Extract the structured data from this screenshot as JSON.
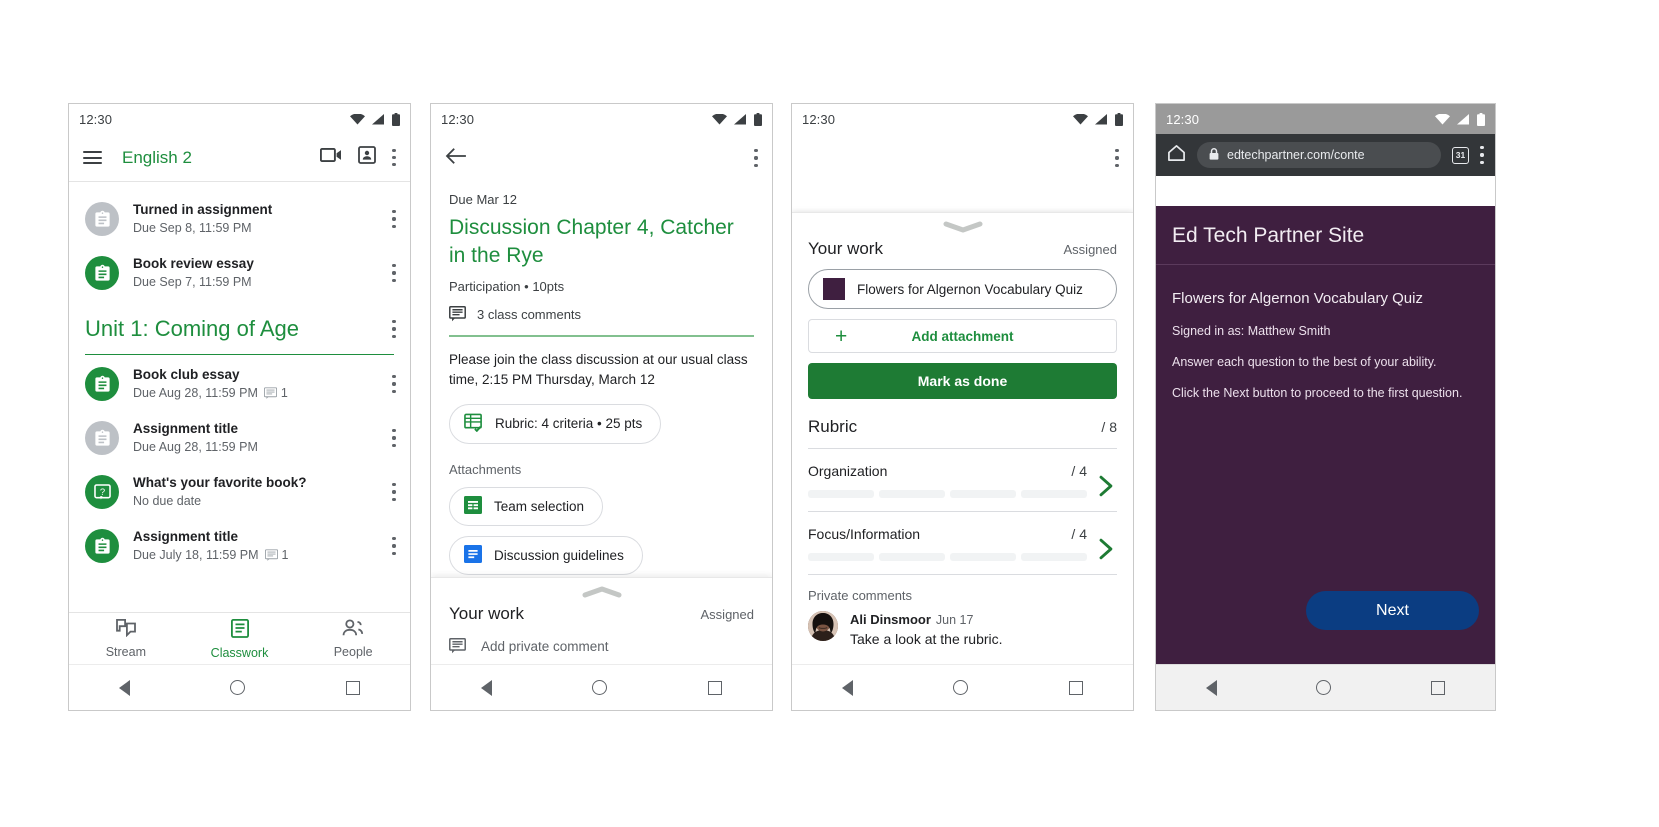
{
  "phone1": {
    "status": {
      "time": "12:30"
    },
    "appbar": {
      "title": "English 2",
      "icons": [
        "video-call-icon",
        "class-card-icon",
        "overflow-menu-icon"
      ]
    },
    "top_items": [
      {
        "title": "Turned in assignment",
        "subtitle": "Due Sep 8, 11:59 PM",
        "state": "grey",
        "icon": "assignment-icon",
        "comments": ""
      },
      {
        "title": "Book review essay",
        "subtitle": "Due Sep 7, 11:59 PM",
        "state": "green",
        "icon": "assignment-icon",
        "comments": ""
      }
    ],
    "unit": {
      "title": "Unit 1: Coming of Age"
    },
    "unit_items": [
      {
        "title": "Book club essay",
        "subtitle": "Due Aug 28, 11:59 PM",
        "state": "green",
        "icon": "assignment-icon",
        "comments": "1"
      },
      {
        "title": "Assignment title",
        "subtitle": "Due Aug 28, 11:59 PM",
        "state": "grey",
        "icon": "assignment-icon",
        "comments": ""
      },
      {
        "title": "What's your favorite book?",
        "subtitle": "No due date",
        "state": "green",
        "icon": "question-icon",
        "comments": ""
      },
      {
        "title": "Assignment title",
        "subtitle": "Due July 18, 11:59 PM",
        "state": "green",
        "icon": "assignment-icon",
        "comments": "1"
      }
    ],
    "tabs": [
      {
        "label": "Stream",
        "icon": "stream-icon",
        "active": false
      },
      {
        "label": "Classwork",
        "icon": "classwork-icon",
        "active": true
      },
      {
        "label": "People",
        "icon": "people-icon",
        "active": false
      }
    ]
  },
  "phone2": {
    "status": {
      "time": "12:30"
    },
    "due": "Due Mar 12",
    "title": "Discussion Chapter 4, Catcher in the Rye",
    "meta": "Participation • 10pts",
    "class_comments": "3 class comments",
    "description": "Please join the class discussion at our usual class time, 2:15 PM Thursday, March 12",
    "rubric_chip": "Rubric: 4 criteria • 25 pts",
    "attachments_label": "Attachments",
    "attachments": [
      {
        "label": "Team selection",
        "icon": "sheets-icon"
      },
      {
        "label": "Discussion guidelines",
        "icon": "docs-icon"
      }
    ],
    "your_work": {
      "title": "Your work",
      "status": "Assigned",
      "private_comment_placeholder": "Add private comment"
    }
  },
  "phone3": {
    "status": {
      "time": "12:30"
    },
    "your_work": {
      "title": "Your work",
      "status": "Assigned"
    },
    "attachment": "Flowers for Algernon Vocabulary Quiz",
    "add_attachment": "Add attachment",
    "mark_as_done": "Mark as done",
    "rubric": {
      "title": "Rubric",
      "score": "/ 8"
    },
    "criteria": [
      {
        "name": "Organization",
        "score": "/ 4"
      },
      {
        "name": "Focus/Information",
        "score": "/ 4"
      }
    ],
    "private_comments_label": "Private comments",
    "comment": {
      "author": "Ali Dinsmoor",
      "date": "Jun 17",
      "body": "Take a look at the rubric."
    }
  },
  "phone4": {
    "status": {
      "time": "12:30"
    },
    "browser": {
      "url": "edtechpartner.com/conte",
      "tab_count": "31"
    },
    "site_title": "Ed Tech Partner Site",
    "quiz_title": "Flowers for Algernon Vocabulary Quiz",
    "lines": [
      "Signed in as: Matthew Smith",
      "Answer each question to the best of your ability.",
      "Click the Next button to proceed to the first question."
    ],
    "next_button": "Next"
  },
  "colors": {
    "classroom_green": "#1e8e3e",
    "button_green": "#1e7b34",
    "site_purple": "#3f1f40",
    "next_blue": "#0b3d82",
    "grey_badge": "#bdc1c6"
  }
}
